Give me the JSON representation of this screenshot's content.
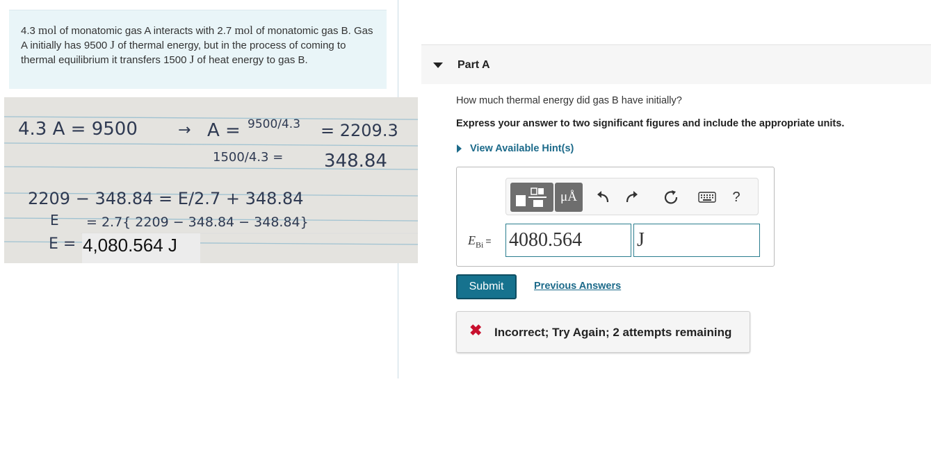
{
  "problem": {
    "part1": "4.3 ",
    "unit_mol_1": "mol",
    "part2": " of monatomic gas A interacts with 2.7 ",
    "unit_mol_2": "mol",
    "part3": " of monatomic gas B. Gas A initially has 9500 ",
    "unit_J_1": "J",
    "part4": " of thermal energy, but in the process of coming to thermal equilibrium it transfers 1500 ",
    "unit_J_2": "J",
    "part5": " of heat energy to gas B."
  },
  "notes": {
    "line1_left": "4.3 A = 9500",
    "line1_arrow": "→",
    "line1_mid": "A =",
    "line1_frac": "9500/4.3",
    "line1_right": "= 2209.3",
    "line2_frac": "1500/4.3 =",
    "line2_right": "348.84",
    "line3": "2209 − 348.84 = E/2.7 + 348.84",
    "line4_label": "E",
    "line4_expr": "= 2.7{ 2209 − 348.84 − 348.84}",
    "line5_label": "E =",
    "line5_typed": "4,080.564 J"
  },
  "part": {
    "title": "Part A"
  },
  "question": "How much thermal energy did gas B have initially?",
  "instruction": "Express your answer to two significant figures and include the appropriate units.",
  "hint_label": "View Available Hint(s)",
  "toolbar": {
    "templates_icon": "templates-icon",
    "units_label": "μÅ",
    "undo_icon": "undo-icon",
    "redo_icon": "redo-icon",
    "reset_icon": "reset-icon",
    "keyboard_icon": "keyboard-icon",
    "help_label": "?"
  },
  "answer": {
    "var_main": "E",
    "var_sub": "Bi",
    "equals": "=",
    "value": "4080.564",
    "unit": "J"
  },
  "submit_label": "Submit",
  "previous_answers_label": "Previous Answers",
  "feedback": {
    "icon": "✖",
    "message": "Incorrect; Try Again; 2 attempts remaining"
  },
  "colors": {
    "problem_bg": "#e9f5f8",
    "accent": "#16728e",
    "link": "#1c6a8a",
    "error": "#c8102e"
  }
}
